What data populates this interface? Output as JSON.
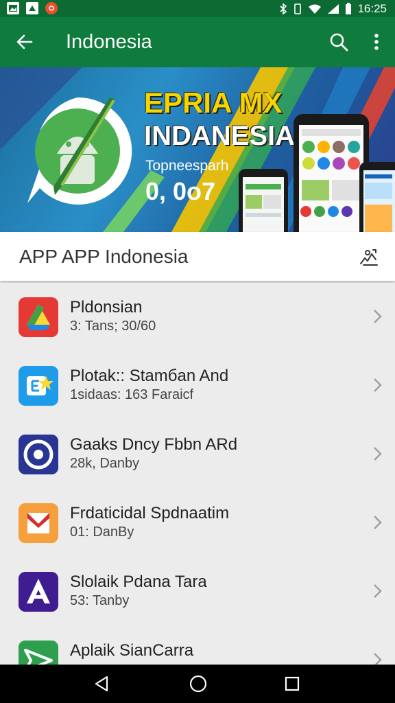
{
  "status_bar": {
    "time": "16:25"
  },
  "toolbar": {
    "title": "Indonesia"
  },
  "banner": {
    "headline1": "EPRIA MX",
    "headline2": "INDANESIA",
    "subtitle": "Topneesparh",
    "number": "0, 0o7"
  },
  "section": {
    "title": "APP APP Indonesia"
  },
  "apps": [
    {
      "title": "Pldonsian",
      "subtitle": "3: Tans; 30/60"
    },
    {
      "title": "Plotak:: Stamбan And",
      "subtitle": "1sidaas: 163 Faraicf"
    },
    {
      "title": "Gaaks Dncy Fbbn ARd",
      "subtitle": "28k, Danby"
    },
    {
      "title": "Frdaticidal Spdnaatim",
      "subtitle": "01: DanBy"
    },
    {
      "title": "Slolaik Pdana Tara",
      "subtitle": "53: Tanby"
    },
    {
      "title": "Aplaik SianCarra",
      "subtitle": ""
    }
  ],
  "colors": {
    "toolbar": "#0f7b3c",
    "status_bar": "#0b6b33",
    "list_bg": "#ececec",
    "nav_bar": "#000000"
  }
}
